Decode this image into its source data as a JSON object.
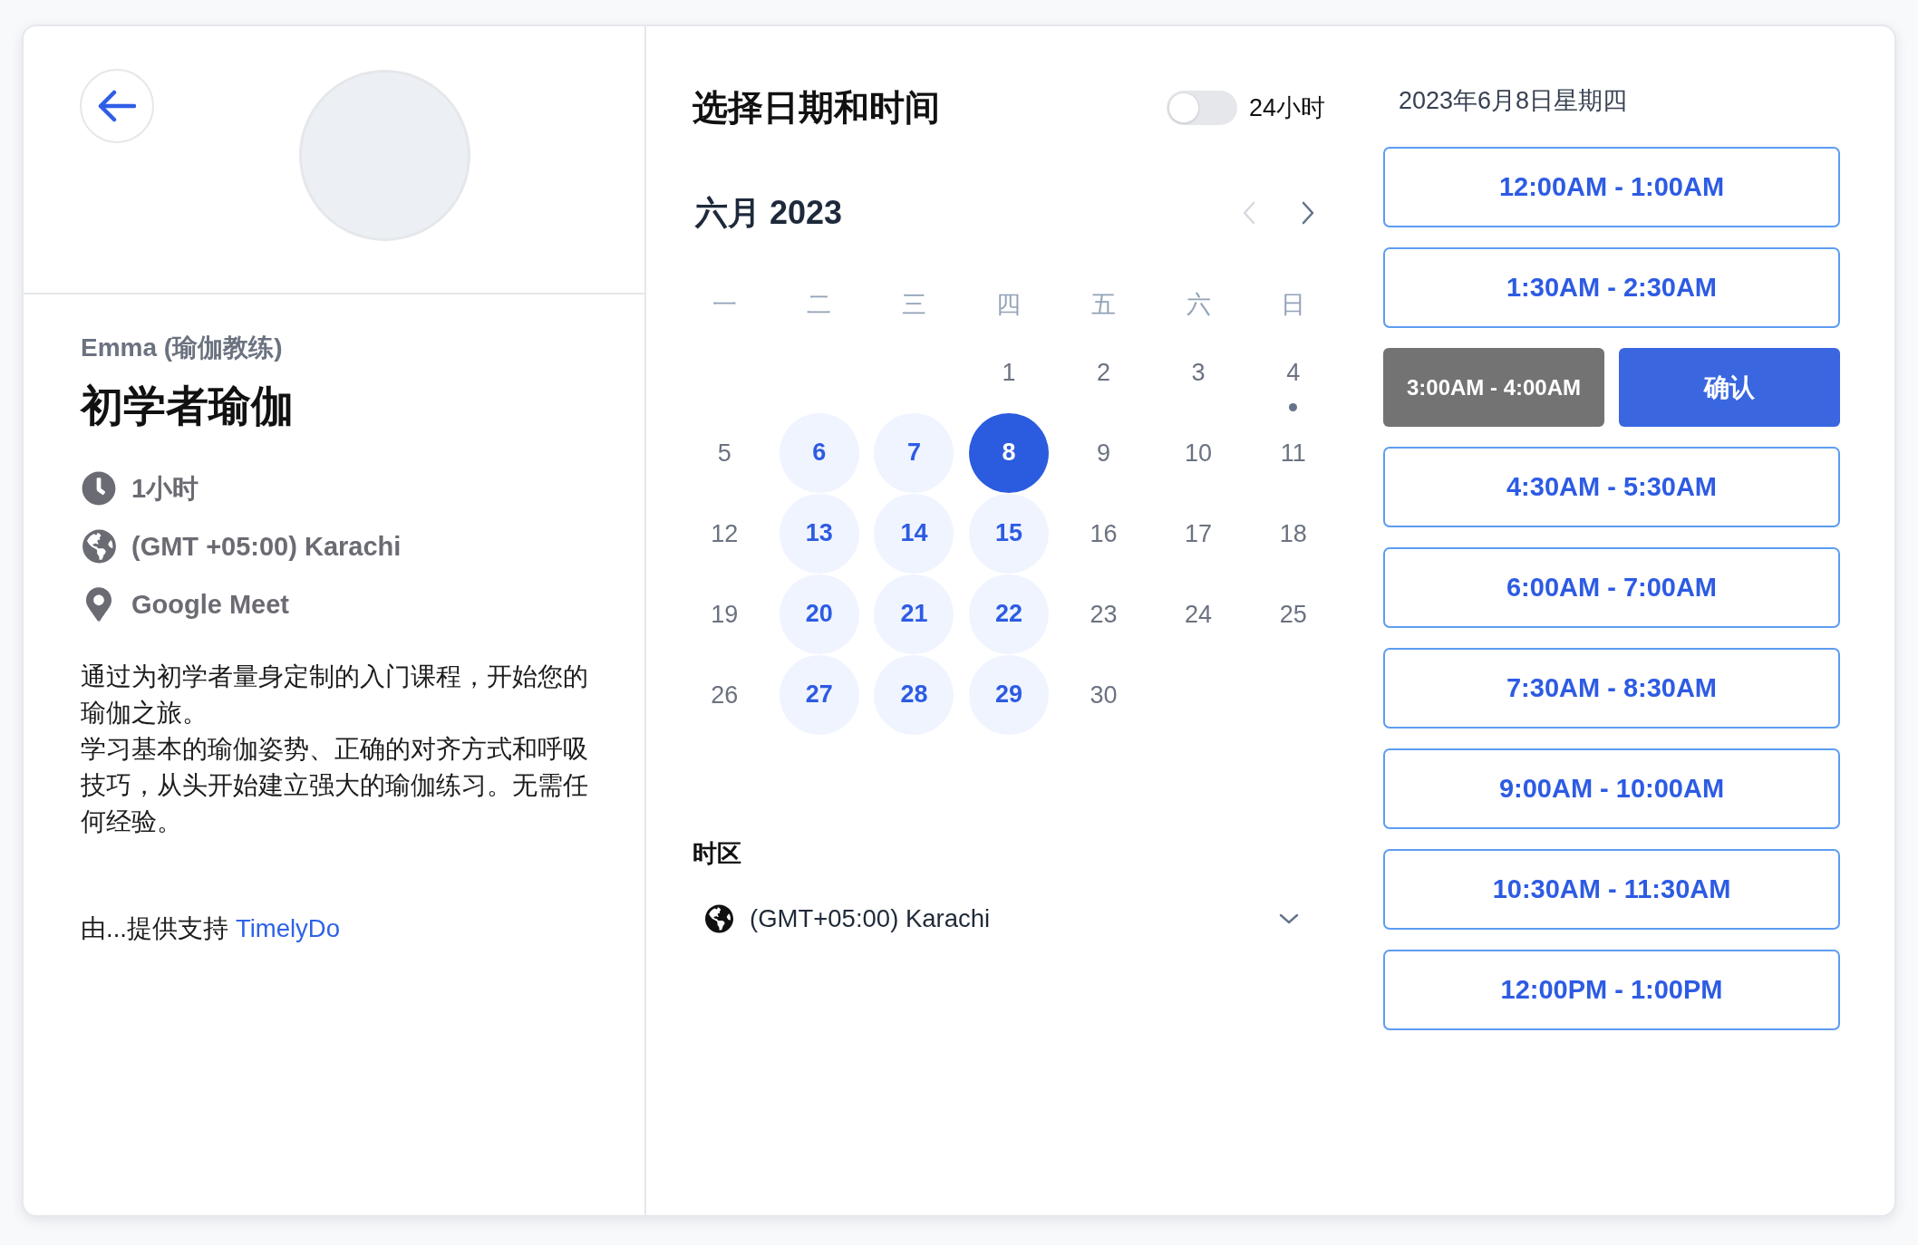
{
  "host": {
    "name": "Emma (瑜伽教练)"
  },
  "event": {
    "title": "初学者瑜伽",
    "details": [
      {
        "kind": "duration",
        "text": "1小时"
      },
      {
        "kind": "timezone",
        "text": "(GMT +05:00) Karachi"
      },
      {
        "kind": "location",
        "text": "Google Meet"
      }
    ],
    "description": [
      "通过为初学者量身定制的入门课程，开始您的瑜伽之旅。",
      "学习基本的瑜伽姿势、正确的对齐方式和呼吸技巧，从头开始建立强大的瑜伽练习。无需任何经验。"
    ]
  },
  "footer": {
    "text": "由...提供支持",
    "link": "TimelyDo"
  },
  "scheduler": {
    "title": "选择日期和时间",
    "clock_toggle": {
      "label": "24小时",
      "on": false
    },
    "month": {
      "label": "六月 2023",
      "prev": {
        "disabled": true
      },
      "next": {
        "disabled": false
      }
    },
    "weekdays": [
      "一",
      "二",
      "三",
      "四",
      "五",
      "六",
      "日"
    ],
    "weeks": [
      {
        "days": [
          {
            "label": "1",
            "available": false,
            "selected": false,
            "today": false
          },
          {
            "label": "2",
            "available": false,
            "selected": false,
            "today": false
          },
          {
            "label": "3",
            "available": false,
            "selected": false,
            "today": false
          },
          {
            "label": "4",
            "available": false,
            "selected": false,
            "today": true
          }
        ]
      },
      {
        "days": [
          {
            "label": "5",
            "available": false,
            "selected": false,
            "today": false
          },
          {
            "label": "6",
            "available": true,
            "selected": false,
            "today": false
          },
          {
            "label": "7",
            "available": true,
            "selected": false,
            "today": false
          },
          {
            "label": "8",
            "available": true,
            "selected": true,
            "today": false
          },
          {
            "label": "9",
            "available": false,
            "selected": false,
            "today": false
          },
          {
            "label": "10",
            "available": false,
            "selected": false,
            "today": false
          },
          {
            "label": "11",
            "available": false,
            "selected": false,
            "today": false
          }
        ]
      },
      {
        "days": [
          {
            "label": "12",
            "available": false,
            "selected": false,
            "today": false
          },
          {
            "label": "13",
            "available": true,
            "selected": false,
            "today": false
          },
          {
            "label": "14",
            "available": true,
            "selected": false,
            "today": false
          },
          {
            "label": "15",
            "available": true,
            "selected": false,
            "today": false
          },
          {
            "label": "16",
            "available": false,
            "selected": false,
            "today": false
          },
          {
            "label": "17",
            "available": false,
            "selected": false,
            "today": false
          },
          {
            "label": "18",
            "available": false,
            "selected": false,
            "today": false
          }
        ]
      },
      {
        "days": [
          {
            "label": "19",
            "available": false,
            "selected": false,
            "today": false
          },
          {
            "label": "20",
            "available": true,
            "selected": false,
            "today": false
          },
          {
            "label": "21",
            "available": true,
            "selected": false,
            "today": false
          },
          {
            "label": "22",
            "available": true,
            "selected": false,
            "today": false
          },
          {
            "label": "23",
            "available": false,
            "selected": false,
            "today": false
          },
          {
            "label": "24",
            "available": false,
            "selected": false,
            "today": false
          },
          {
            "label": "25",
            "available": false,
            "selected": false,
            "today": false
          }
        ]
      },
      {
        "days": [
          {
            "label": "26",
            "available": false,
            "selected": false,
            "today": false
          },
          {
            "label": "27",
            "available": true,
            "selected": false,
            "today": false
          },
          {
            "label": "28",
            "available": true,
            "selected": false,
            "today": false
          },
          {
            "label": "29",
            "available": true,
            "selected": false,
            "today": false
          },
          {
            "label": "30",
            "available": false,
            "selected": false,
            "today": false
          }
        ]
      }
    ]
  },
  "timezone": {
    "label": "时区",
    "value": "(GMT+05:00) Karachi"
  },
  "time_slots": {
    "date": "2023年6月8日星期四",
    "confirm_label": "确认",
    "items": [
      {
        "label": "12:00AM - 1:00AM",
        "selected": false
      },
      {
        "label": "1:30AM - 2:30AM",
        "selected": false
      },
      {
        "label": "3:00AM - 4:00AM",
        "selected": true
      },
      {
        "label": "4:30AM - 5:30AM",
        "selected": false
      },
      {
        "label": "6:00AM - 7:00AM",
        "selected": false
      },
      {
        "label": "7:30AM - 8:30AM",
        "selected": false
      },
      {
        "label": "9:00AM - 10:00AM",
        "selected": false
      },
      {
        "label": "10:30AM - 11:30AM",
        "selected": false
      },
      {
        "label": "12:00PM - 1:00PM",
        "selected": false
      }
    ]
  }
}
